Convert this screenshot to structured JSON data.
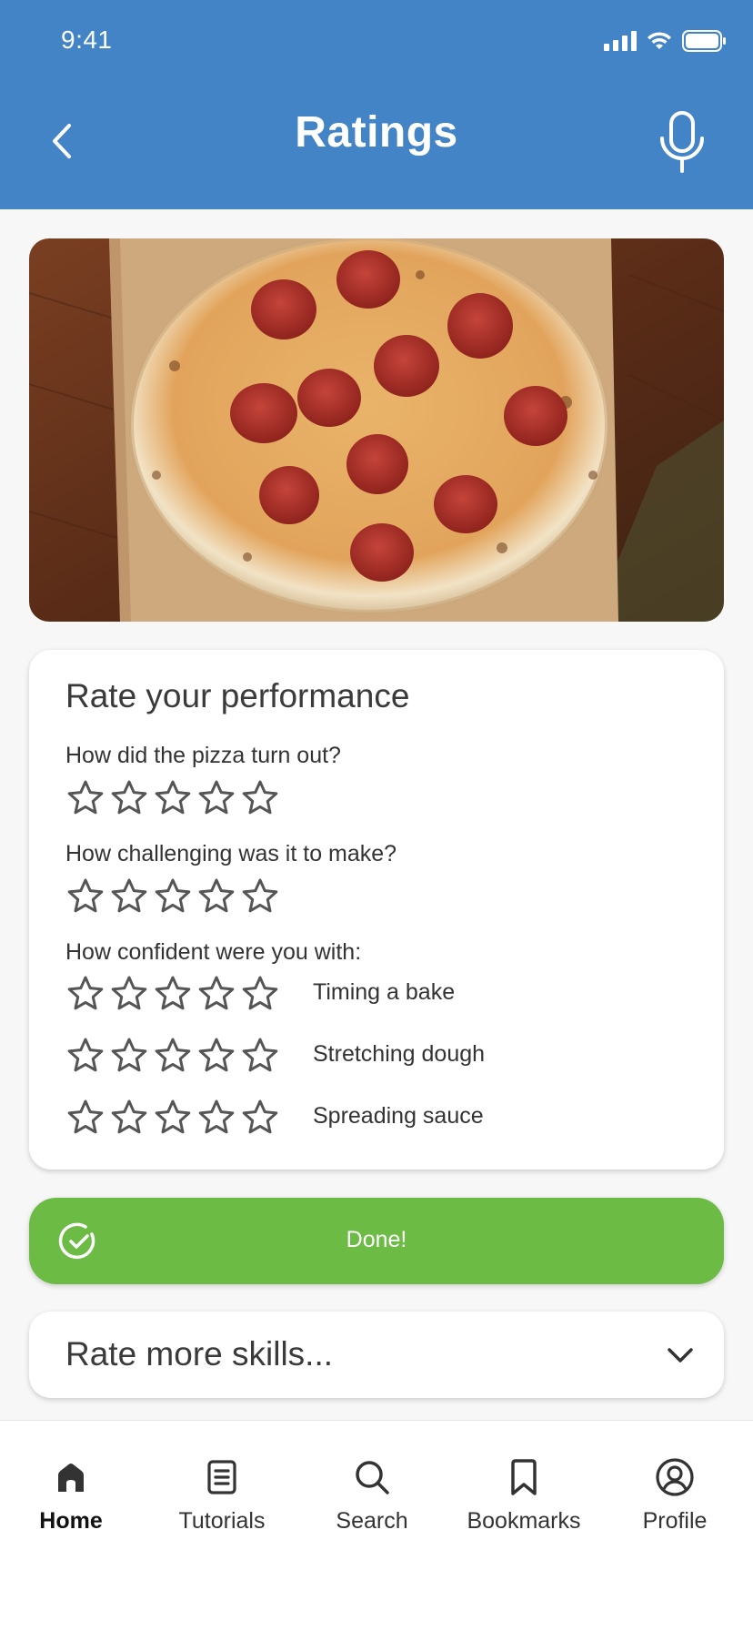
{
  "status": {
    "time": "9:41"
  },
  "header": {
    "title": "Ratings"
  },
  "photo": {
    "alt": "pepperoni pizza on wooden peel"
  },
  "card": {
    "title": "Rate your performance",
    "q1": {
      "text": "How did the pizza turn out?",
      "rating": 0,
      "max": 5
    },
    "q2": {
      "text": "How challenging was it to make?",
      "rating": 0,
      "max": 5
    },
    "q3": {
      "text": "How confident were you with:",
      "skills": [
        {
          "label": "Timing a bake",
          "rating": 0,
          "max": 5
        },
        {
          "label": "Stretching dough",
          "rating": 0,
          "max": 5
        },
        {
          "label": "Spreading sauce",
          "rating": 0,
          "max": 5
        }
      ]
    }
  },
  "done_button": {
    "label": "Done!"
  },
  "more_skills": {
    "label": "Rate more skills..."
  },
  "tabbar": {
    "active": "Home",
    "items": [
      {
        "label": "Home",
        "icon": "home-icon"
      },
      {
        "label": "Tutorials",
        "icon": "document-icon"
      },
      {
        "label": "Search",
        "icon": "search-icon"
      },
      {
        "label": "Bookmarks",
        "icon": "bookmark-icon"
      },
      {
        "label": "Profile",
        "icon": "profile-icon"
      }
    ]
  },
  "colors": {
    "header": "#4384c6",
    "done": "#6cbb45",
    "star_outline": "#555555"
  }
}
